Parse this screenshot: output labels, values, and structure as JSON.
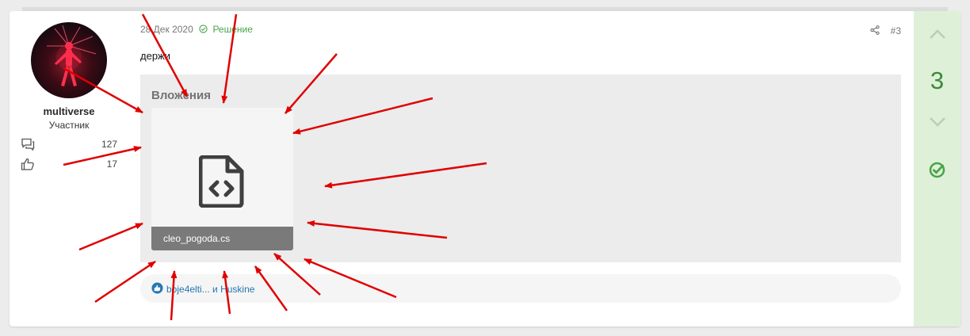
{
  "post": {
    "user": {
      "name": "multiverse",
      "title": "Участник",
      "messages_count": "127",
      "reactions_count": "17"
    },
    "message": {
      "date": "28 Дек 2020",
      "solution_label": "Решение",
      "post_number": "#3",
      "body": "держи"
    },
    "attachments": {
      "title": "Вложения",
      "files": [
        {
          "name": "cleo_pogoda.cs",
          "icon": "code-file-icon"
        }
      ]
    },
    "reactions": {
      "text": "boje4elti... и Huskine",
      "icon": "like-icon"
    },
    "vote": {
      "score": "3"
    }
  },
  "colors": {
    "solution": "#47a447",
    "vote_panel": "#dff0d8",
    "link": "#2577b1",
    "arrow": "#e00000"
  }
}
